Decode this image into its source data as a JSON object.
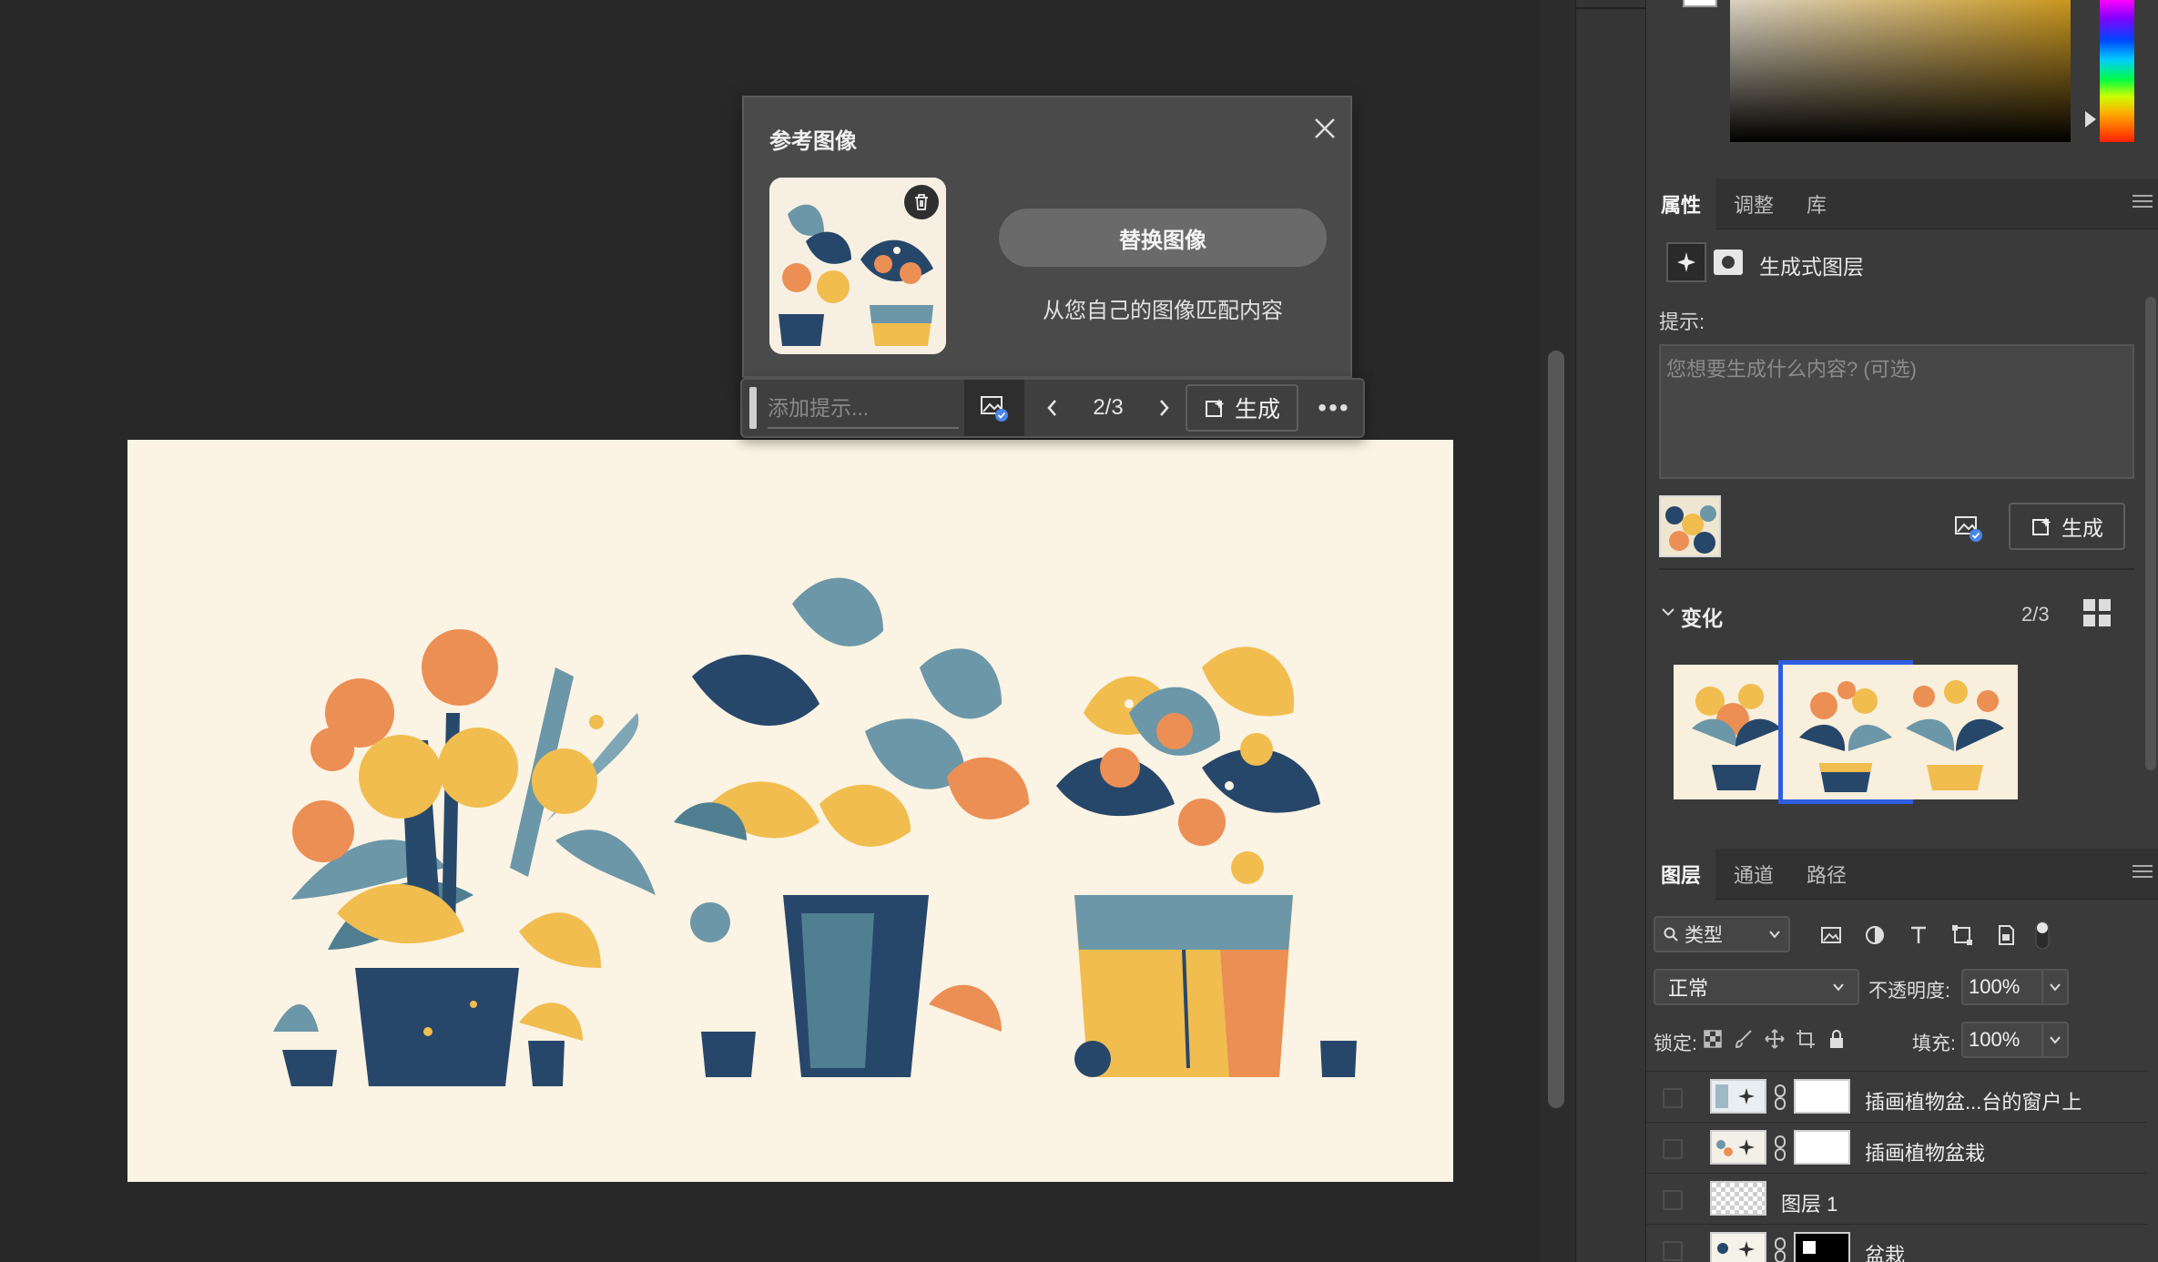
{
  "reference_popup": {
    "title": "参考图像",
    "replace_button": "替换图像",
    "match_text": "从您自己的图像匹配内容"
  },
  "taskbar": {
    "prompt_placeholder": "添加提示...",
    "variation_counter": "2/3",
    "generate_label": "生成",
    "more_label": "•••"
  },
  "properties": {
    "tabs": [
      "属性",
      "调整",
      "库"
    ],
    "layer_type_label": "生成式图层",
    "prompt_label": "提示:",
    "prompt_placeholder": "您想要生成什么内容? (可选)",
    "generate_label": "生成",
    "variations_label": "变化",
    "variations_count": "2/3",
    "selected_variation": 2
  },
  "layers": {
    "tabs": [
      "图层",
      "通道",
      "路径"
    ],
    "filter_label": "类型",
    "blend_mode": "正常",
    "opacity_label": "不透明度:",
    "opacity_value": "100%",
    "lock_label": "锁定:",
    "fill_label": "填充:",
    "fill_value": "100%",
    "items": [
      {
        "name": "插画植物盆...台的窗户上"
      },
      {
        "name": "插画植物盆栽"
      },
      {
        "name": "图层 1"
      },
      {
        "name": "盆栽"
      }
    ]
  },
  "colors": {
    "accent_selected": "#2f5ee0",
    "canvas_background": "#fbf3e3",
    "panel_background": "#3a3a3a"
  }
}
